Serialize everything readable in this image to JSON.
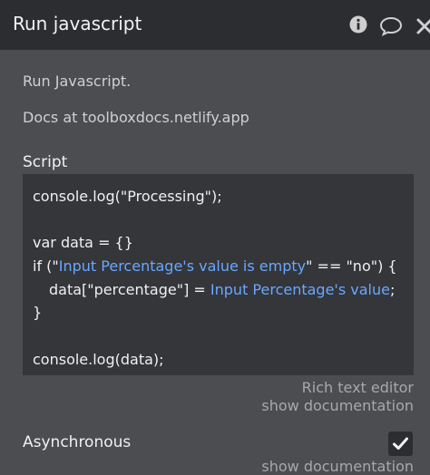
{
  "header": {
    "title": "Run javascript",
    "icons": [
      "info-icon",
      "comment-icon",
      "close-icon"
    ]
  },
  "description": {
    "line1": "Run Javascript.",
    "line2": "Docs at toolboxdocs.netlify.app"
  },
  "script": {
    "label": "Script",
    "line1": "console.log(\"Processing\");",
    "line3": "var data = {}",
    "line4_pre": "if (\"",
    "line4_dyn": "Input Percentage's value is empty",
    "line4_post": "\" == \"no\") {",
    "line5_pre": "data[\"percentage\"] = ",
    "line5_dyn": "Input Percentage's value",
    "line5_post": ";",
    "line6": "}",
    "line8": "console.log(data);"
  },
  "links": {
    "rich_text": "Rich text editor",
    "show_doc": "show documentation",
    "show_doc_cut": "show documentation"
  },
  "asynchronous": {
    "label": "Asynchronous",
    "checked": true
  },
  "colors": {
    "header_bg": "#2b2d31",
    "panel_bg": "#4b4d51",
    "code_bg": "#34363a",
    "dynamic_text": "#6aa7ff"
  }
}
